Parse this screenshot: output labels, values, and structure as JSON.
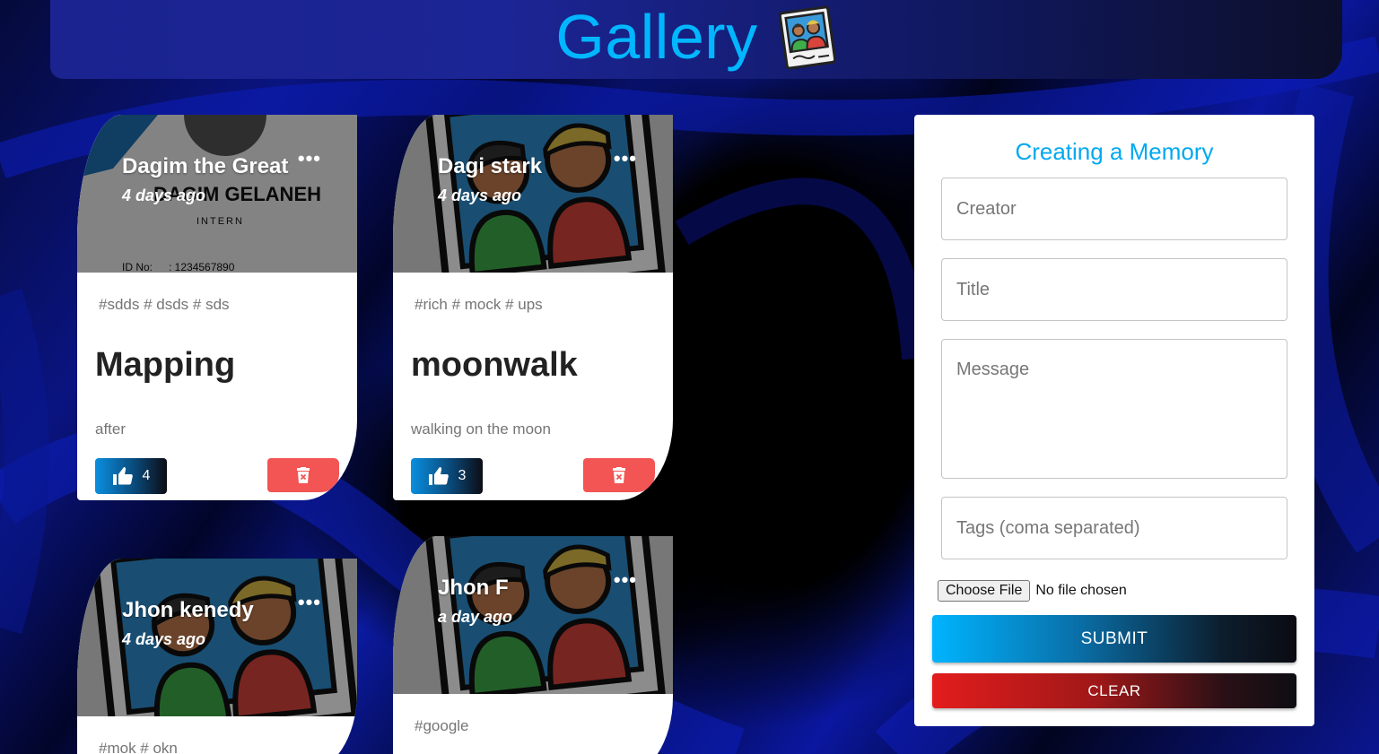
{
  "header": {
    "title": "Gallery"
  },
  "posts": [
    {
      "creator": "Dagim the Great",
      "time": "4 days ago",
      "tags": "#sdds # dsds # sds",
      "title": "Mapping",
      "message": "after",
      "likes": "4",
      "photo_text": {
        "name": "DAGIM GELANEH",
        "role": "INTERN",
        "id_label": "ID No:",
        "id_value": ": 1234567890"
      }
    },
    {
      "creator": "Dagi stark",
      "time": "4 days ago",
      "tags": "#rich # mock # ups",
      "title": "moonwalk",
      "message": "walking on the moon",
      "likes": "3"
    },
    {
      "creator": "Jhon kenedy",
      "time": "4 days ago",
      "tags": "#mok # okn"
    },
    {
      "creator": "Jhon F",
      "time": "a day ago",
      "tags": "#google"
    }
  ],
  "form": {
    "title": "Creating a Memory",
    "creator_placeholder": "Creator",
    "title_placeholder": "Title",
    "message_placeholder": "Message",
    "tags_placeholder": "Tags (coma separated)",
    "file_button": "Choose File",
    "file_status": "No file chosen",
    "submit_label": "SUBMIT",
    "clear_label": "CLEAR"
  },
  "colors": {
    "accent": "#00b7ff",
    "delete": "#f35454",
    "clear": "#e31c1c"
  }
}
